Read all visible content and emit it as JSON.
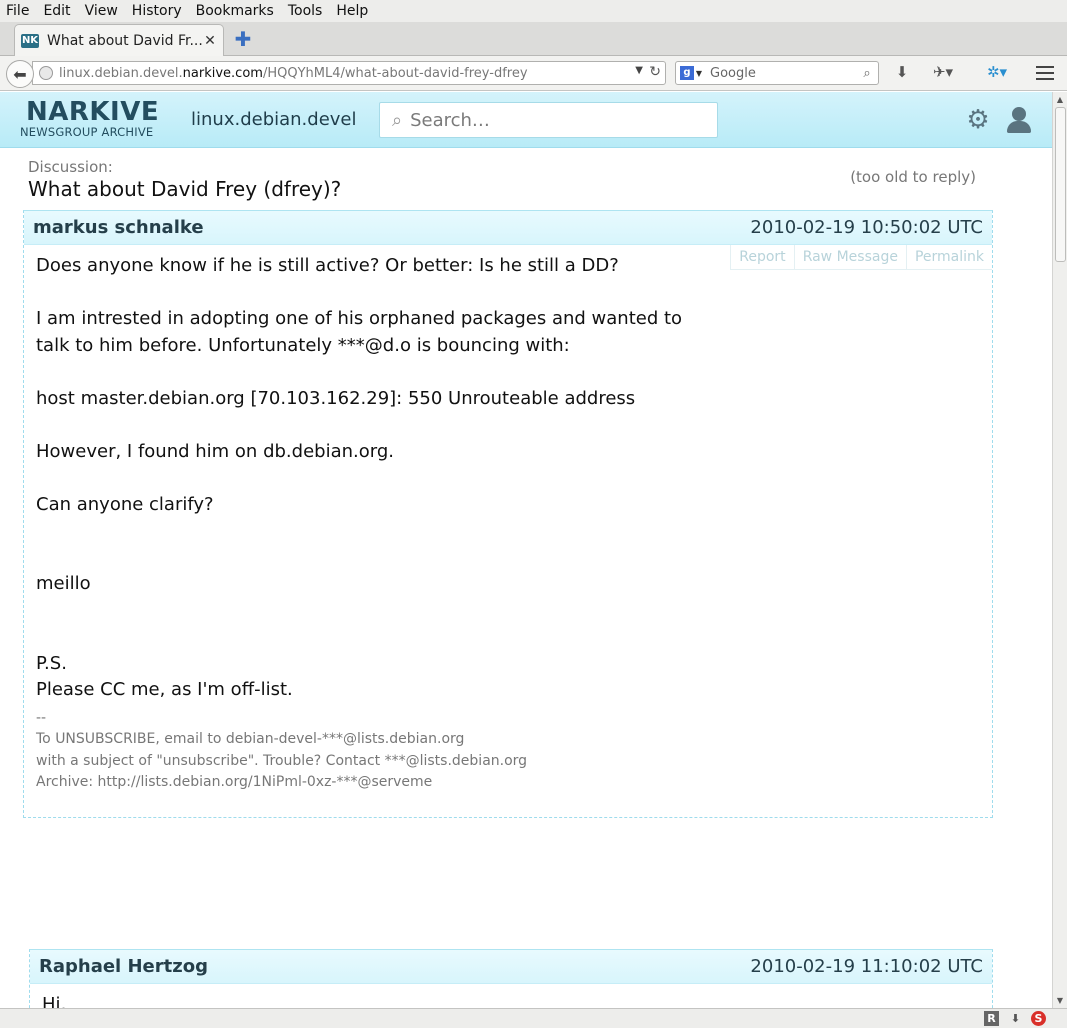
{
  "browser": {
    "menu": [
      "File",
      "Edit",
      "View",
      "History",
      "Bookmarks",
      "Tools",
      "Help"
    ],
    "tab_title": "What about David Fr...",
    "tab_favicon": "NK",
    "url_prefix": "linux.debian.devel.",
    "url_domain": "narkive.com",
    "url_path": "/HQQYhML4/what-about-david-frey-dfrey",
    "search_engine_placeholder": "Google"
  },
  "site": {
    "logo_main": "NARKIVE",
    "logo_sub": "NEWSGROUP ARCHIVE",
    "group": "linux.debian.devel",
    "search_placeholder": "Search…"
  },
  "discussion": {
    "label": "Discussion:",
    "title": "What about David Frey (dfrey)?",
    "status": "(too old to reply)"
  },
  "messages": [
    {
      "author": "markus schnalke",
      "date": "2010-02-19 10:50:02 UTC",
      "actions": [
        "Report",
        "Raw Message",
        "Permalink"
      ],
      "body": "Does anyone know if he is still active? Or better: Is he still a DD?\n\nI am intrested in adopting one of his orphaned packages and wanted to\ntalk to him before. Unfortunately ***@d.o is bouncing with:\n\nhost master.debian.org [70.103.162.29]: 550 Unrouteable address\n\nHowever, I found him on db.debian.org.\n\nCan anyone clarify?\n\n\nmeillo\n\n\nP.S.\nPlease CC me, as I'm off-list.",
      "signature": "--\nTo UNSUBSCRIBE, email to debian-devel-***@lists.debian.org\nwith a subject of \"unsubscribe\". Trouble? Contact ***@lists.debian.org\nArchive: http://lists.debian.org/1NiPml-0xz-***@serveme"
    },
    {
      "author": "Raphael Hertzog",
      "date": "2010-02-19 11:10:02 UTC",
      "body": "Hi,"
    }
  ]
}
